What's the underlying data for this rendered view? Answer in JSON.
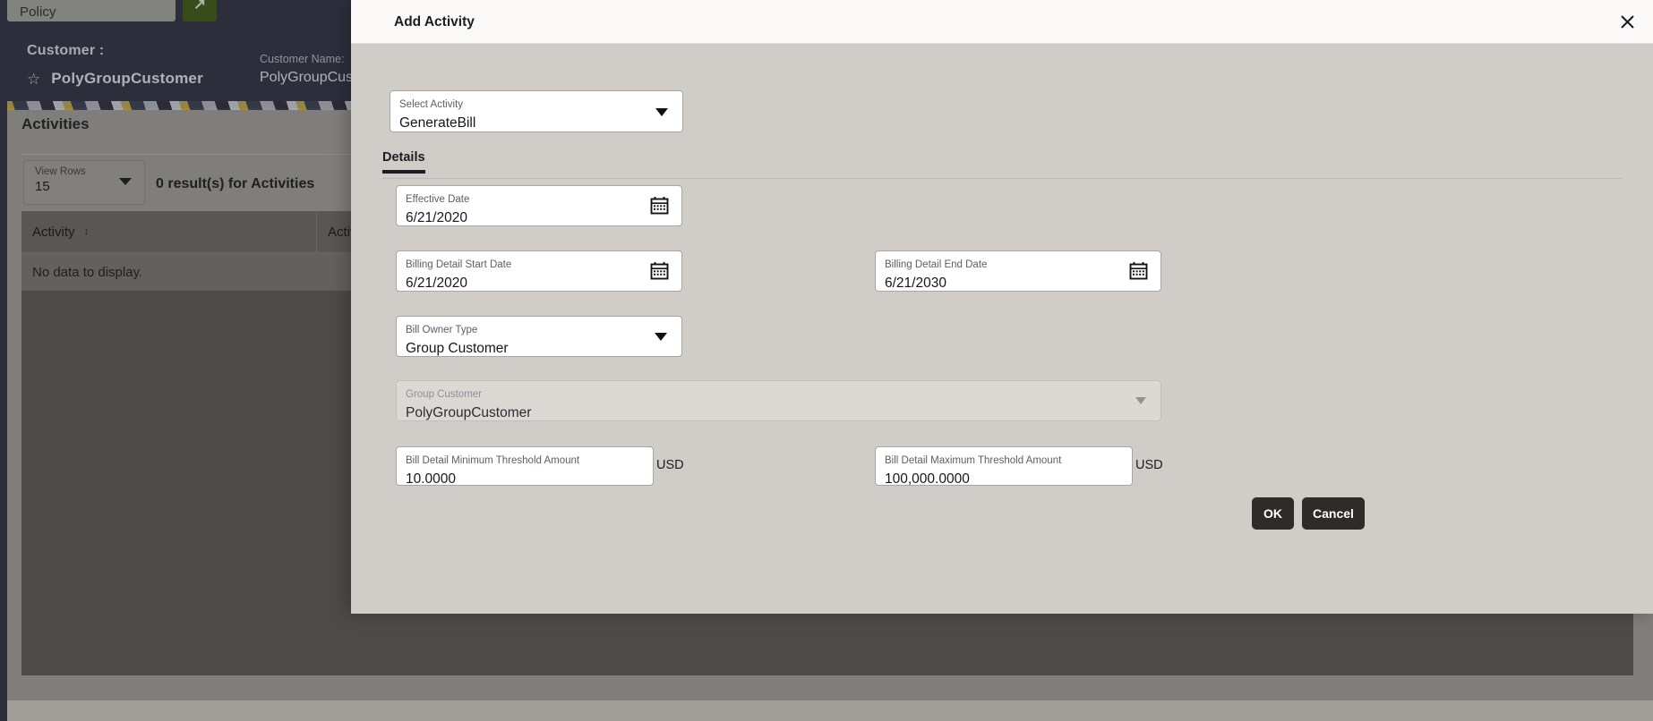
{
  "background": {
    "policy_select": {
      "label": "Policy",
      "icon": "chevron-down-icon"
    },
    "go_button": {
      "label": "↗"
    },
    "customer_heading": "Customer :",
    "customer_name_big": "PolyGroupCustomer",
    "customer_name_field": {
      "label": "Customer Name:",
      "value": "PolyGroupCusto"
    },
    "panel": {
      "title": "Activities",
      "view_rows": {
        "label": "View Rows",
        "value": "15"
      },
      "results_text": "0 result(s) for Activities",
      "columns": [
        "Activity",
        "Activity"
      ],
      "empty_message": "No data to display."
    }
  },
  "modal": {
    "title": "Add Activity",
    "close_icon": "close-icon",
    "select_activity": {
      "label": "Select Activity",
      "value": "GenerateBill",
      "icon": "chevron-down-icon"
    },
    "tabs": [
      {
        "label": "Details",
        "active": true
      }
    ],
    "fields": {
      "effective_date": {
        "label": "Effective Date",
        "value": "6/21/2020",
        "icon": "calendar-icon"
      },
      "billing_detail_start_date": {
        "label": "Billing Detail Start Date",
        "value": "6/21/2020",
        "icon": "calendar-icon"
      },
      "billing_detail_end_date": {
        "label": "Billing Detail End Date",
        "value": "6/21/2030",
        "icon": "calendar-icon"
      },
      "bill_owner_type": {
        "label": "Bill Owner Type",
        "value": "Group Customer",
        "icon": "chevron-down-icon"
      },
      "group_customer": {
        "label": "Group Customer",
        "value": "PolyGroupCustomer",
        "icon": "chevron-down-icon",
        "disabled": true
      },
      "bill_detail_minimum_threshold_amount": {
        "label": "Bill Detail Minimum Threshold Amount",
        "value": "10.0000",
        "unit": "USD"
      },
      "bill_detail_maximum_threshold_amount": {
        "label": "Bill Detail Maximum Threshold Amount",
        "value": "100,000.0000",
        "unit": "USD"
      }
    },
    "buttons": {
      "ok": "OK",
      "cancel": "Cancel"
    }
  },
  "colors": {
    "modal_bg": "#d0cdc8",
    "modal_header_bg": "#faf9f7",
    "button_dark": "#2f2b28",
    "topbar_navy": "#2e3245",
    "go_green": "#3e5c16",
    "field_white": "#ffffff",
    "field_disabled": "#dcd9d4"
  }
}
